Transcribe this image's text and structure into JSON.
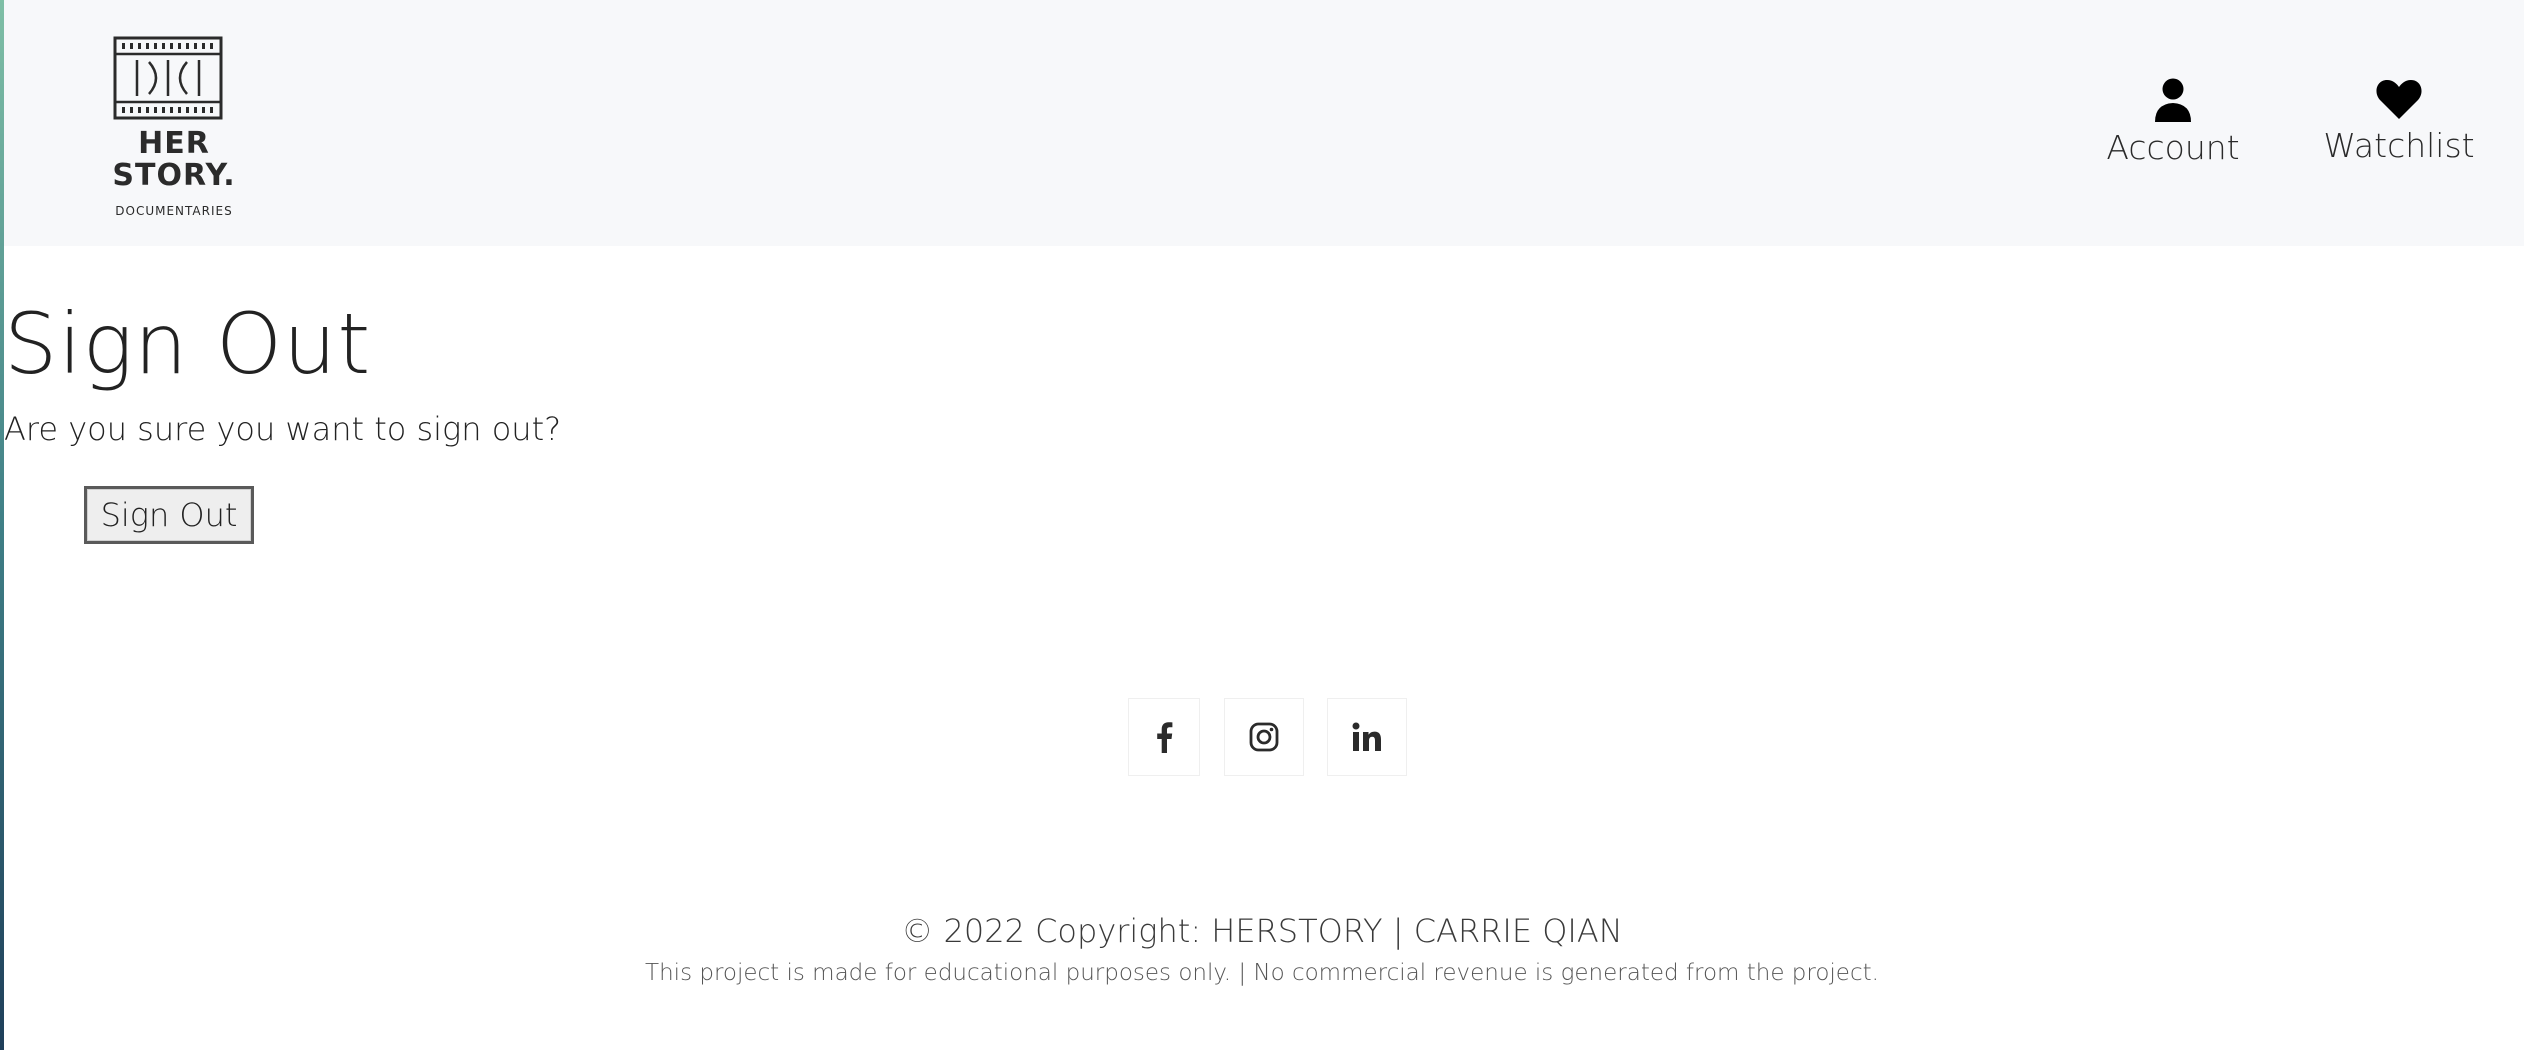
{
  "header": {
    "logo": {
      "line1": "HER",
      "line2": "STORY.",
      "subtitle": "DOCUMENTARIES"
    },
    "nav": {
      "account_label": "Account",
      "watchlist_label": "Watchlist"
    }
  },
  "main": {
    "title": "Sign Out",
    "prompt": "Are you sure you want to sign out?",
    "button_label": "Sign Out"
  },
  "social": {
    "items": [
      "facebook-icon",
      "instagram-icon",
      "linkedin-icon"
    ]
  },
  "footer": {
    "copyright": "© 2022 Copyright: HERSTORY | CARRIE QIAN",
    "disclaimer": "This project is made for educational purposes only. | No commercial revenue is generated from the project."
  }
}
